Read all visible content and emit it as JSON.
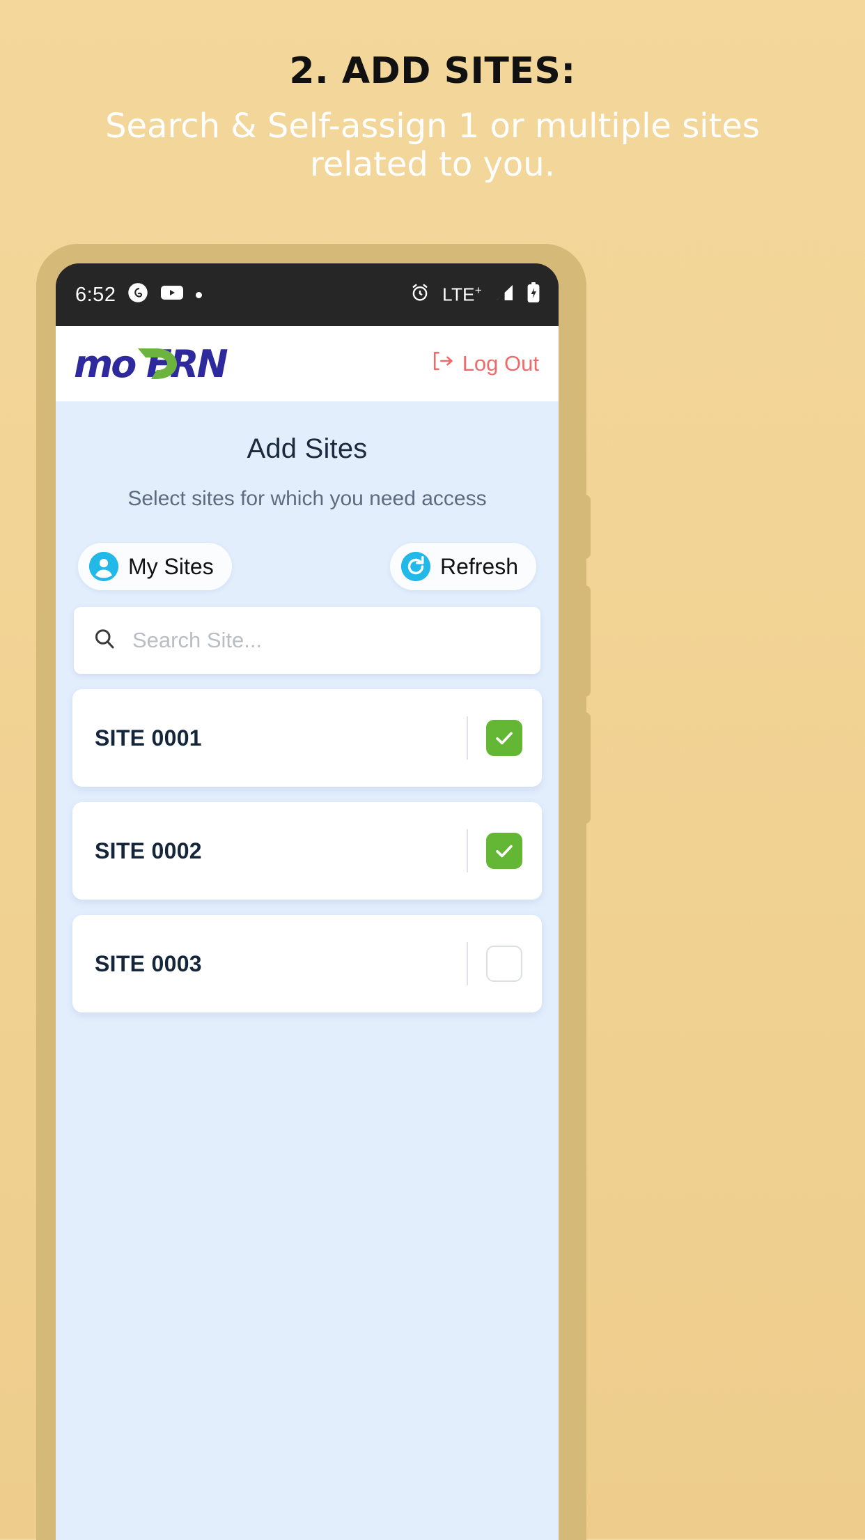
{
  "promo": {
    "title": "2. ADD SITES:",
    "subtitle": "Search & Self-assign 1 or multiple sites related to you."
  },
  "statusbar": {
    "time": "6:52",
    "notification_icons": [
      "threads-icon",
      "youtube-icon",
      "dot-icon"
    ],
    "alarm_icon": "alarm-icon",
    "network": "LTE",
    "network_plus": "+",
    "signal_icon": "signal-icon",
    "battery_icon": "battery-charging-icon"
  },
  "appbar": {
    "logo_text": "MODERN",
    "logo_color_primary": "#2e2a9e",
    "logo_color_accent": "#6cb33f",
    "logout_label": "Log Out",
    "logout_color": "#ef6b6b"
  },
  "page": {
    "title": "Add Sites",
    "subtitle": "Select sites for which you need access"
  },
  "actions": {
    "my_sites_label": "My Sites",
    "refresh_label": "Refresh",
    "icon_color": "#22b8e8"
  },
  "search": {
    "placeholder": "Search Site...",
    "value": ""
  },
  "sites": [
    {
      "name": "SITE 0001",
      "checked": true
    },
    {
      "name": "SITE 0002",
      "checked": true
    },
    {
      "name": "SITE 0003",
      "checked": false
    }
  ],
  "colors": {
    "background": "#f2d496",
    "bezel": "#d4b978",
    "screen": "#e2eefc",
    "statusbar": "#262626",
    "check_green": "#63b735"
  }
}
